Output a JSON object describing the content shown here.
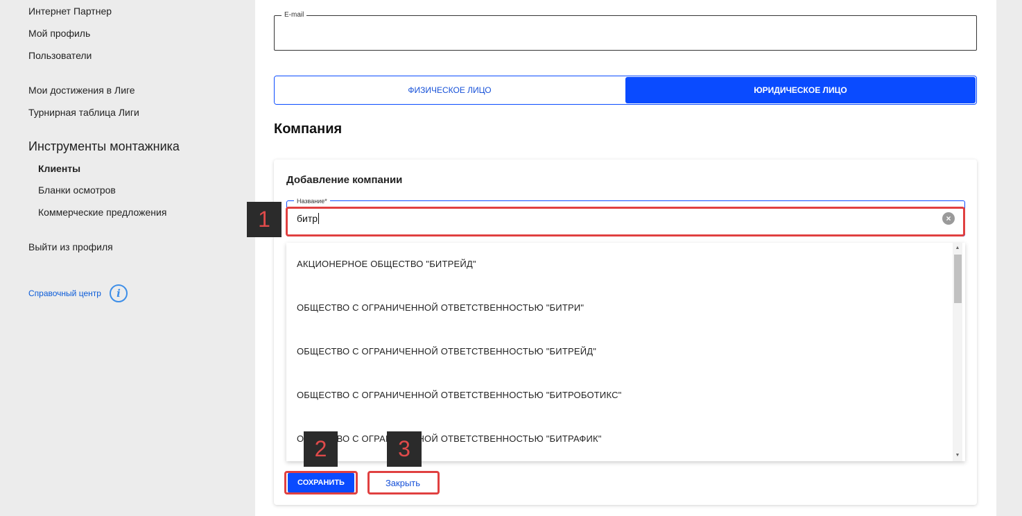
{
  "sidebar": {
    "links_top": [
      "Интернет Партнер",
      "Мой профиль",
      "Пользователи"
    ],
    "links_league": [
      "Мои достижения в Лиге",
      "Турнирная таблица Лиги"
    ],
    "tools_heading": "Инструменты монтажника",
    "tools_items": [
      "Клиенты",
      "Бланки осмотров",
      "Коммерческие предложения"
    ],
    "logout": "Выйти из профиля",
    "help_label": "Справочный центр",
    "help_icon": "info-icon"
  },
  "form": {
    "email_label": "E-mail",
    "email_value": "",
    "toggle_individual": "ФИЗИЧЕСКОЕ ЛИЦО",
    "toggle_legal": "ЮРИДИЧЕСКОЕ ЛИЦО",
    "toggle_selected": "legal",
    "section_title": "Компания"
  },
  "company_card": {
    "title": "Добавление компании",
    "name_label": "Название*",
    "name_value": "битр",
    "suggestions": [
      "АКЦИОНЕРНОЕ ОБЩЕСТВО \"БИТРЕЙД\"",
      "ОБЩЕСТВО С ОГРАНИЧЕННОЙ ОТВЕТСТВЕННОСТЬЮ \"БИТРИ\"",
      "ОБЩЕСТВО С ОГРАНИЧЕННОЙ ОТВЕТСТВЕННОСТЬЮ \"БИТРЕЙД\"",
      "ОБЩЕСТВО С ОГРАНИЧЕННОЙ ОТВЕТСТВЕННОСТЬЮ \"БИТРОБОТИКС\"",
      "ОБЩЕСТВО С ОГРАНИЧЕННОЙ ОТВЕТСТВЕННОСТЬЮ \"БИТРАФИК\""
    ],
    "save_label": "СОХРАНИТЬ",
    "close_label": "Закрыть"
  },
  "annotations": [
    "1",
    "2",
    "3"
  ],
  "colors": {
    "accent": "#0a4bff",
    "annotation_red": "#e04040",
    "sidebar_bg": "#ececec"
  }
}
